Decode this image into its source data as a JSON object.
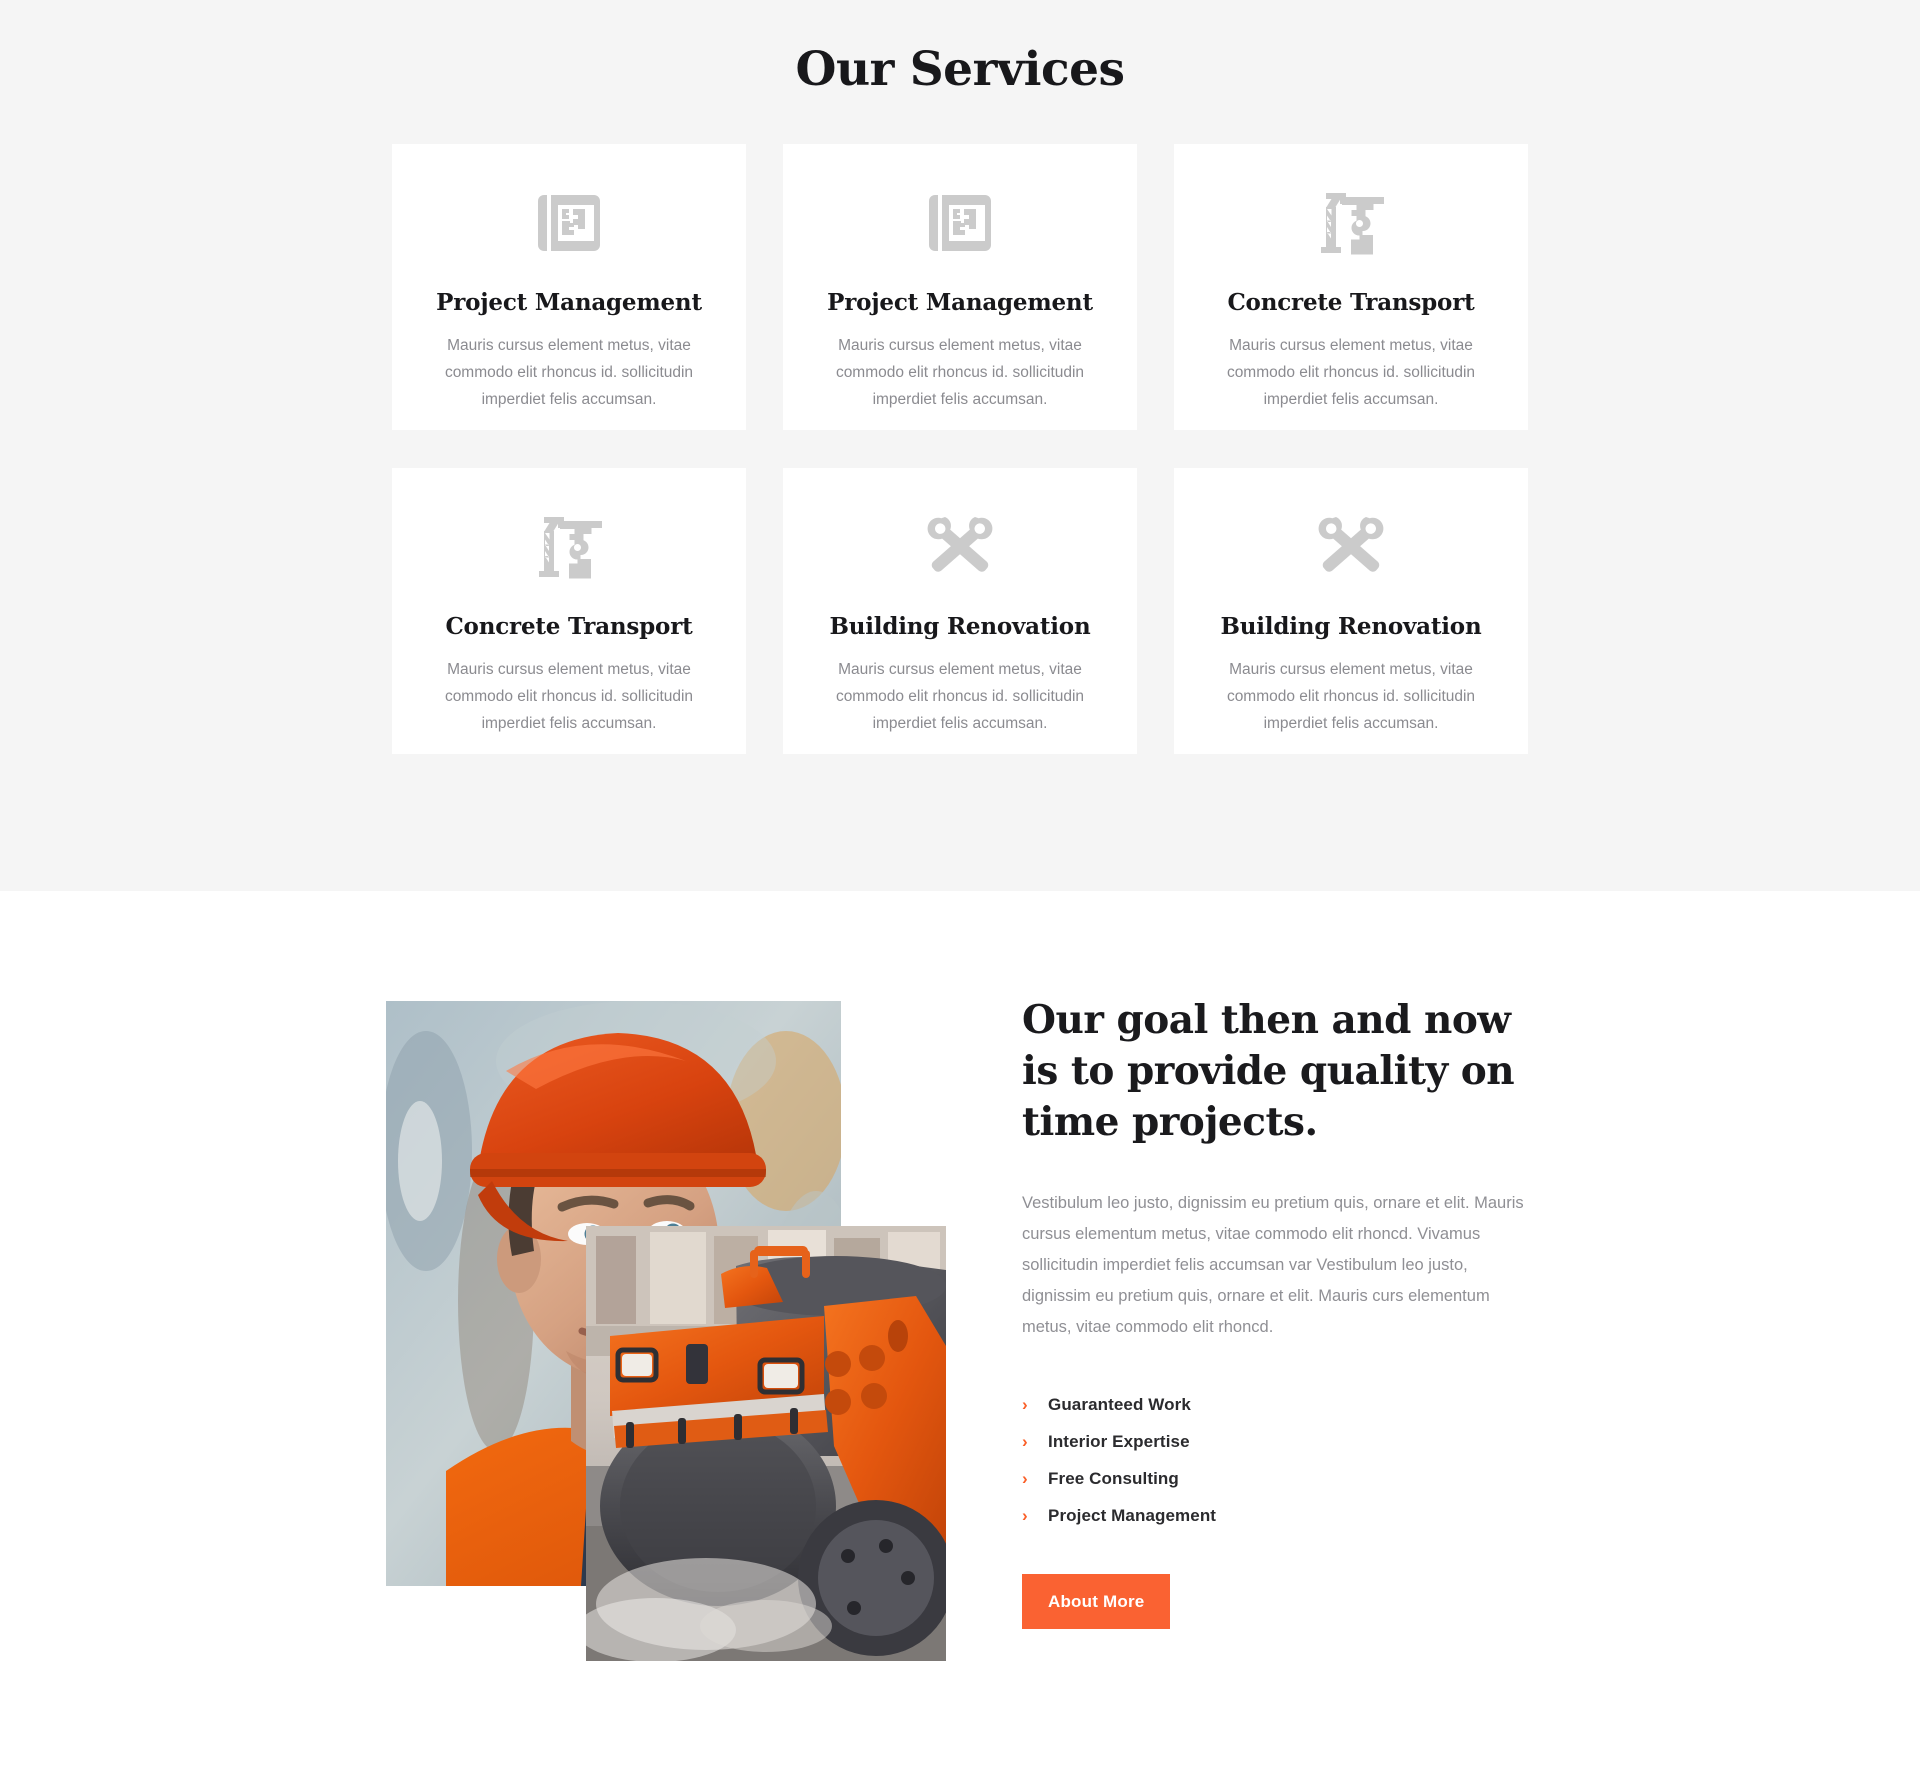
{
  "services": {
    "title": "Our Services",
    "cards": [
      {
        "icon": "blueprint-icon",
        "title": "Project Management",
        "desc": "Mauris cursus element metus, vitae commodo elit rhoncus id. sollicitudin imperdiet felis accumsan."
      },
      {
        "icon": "blueprint-icon",
        "title": "Project Management",
        "desc": "Mauris cursus element metus, vitae commodo elit rhoncus id. sollicitudin imperdiet felis accumsan."
      },
      {
        "icon": "crane-icon",
        "title": "Concrete Transport",
        "desc": "Mauris cursus element metus, vitae commodo elit rhoncus id. sollicitudin imperdiet felis accumsan."
      },
      {
        "icon": "crane-icon",
        "title": "Concrete Transport",
        "desc": "Mauris cursus element metus, vitae commodo elit rhoncus id. sollicitudin imperdiet felis accumsan."
      },
      {
        "icon": "wrenches-icon",
        "title": "Building Renovation",
        "desc": "Mauris cursus element metus, vitae commodo elit rhoncus id. sollicitudin imperdiet felis accumsan."
      },
      {
        "icon": "wrenches-icon",
        "title": "Building Renovation",
        "desc": "Mauris cursus element metus, vitae commodo elit rhoncus id. sollicitudin imperdiet felis accumsan."
      }
    ]
  },
  "about": {
    "heading": "Our goal then and now is to provide quality on time projects.",
    "paragraph": "Vestibulum leo justo, dignissim eu pretium quis, ornare et elit. Mauris cursus elementum metus, vitae commodo elit rhoncd. Vivamus sollicitudin imperdiet felis accumsan var Vestibulum leo justo, dignissim eu pretium quis, ornare et elit. Mauris curs elementum metus, vitae commodo elit rhoncd.",
    "chevron": "›",
    "features": [
      "Guaranteed Work",
      "Interior Expertise",
      "Free Consulting",
      "Project Management"
    ],
    "button_label": "About More",
    "images": [
      {
        "name": "worker-with-phone-photo",
        "alt": "Construction worker in orange hard hat and safety vest talking on a mobile phone"
      },
      {
        "name": "road-roller-photo",
        "alt": "Orange road roller compacting asphalt with dust"
      }
    ]
  },
  "colors": {
    "accent": "#fa6232",
    "chevron": "#fa5f28",
    "section_bg": "#f5f5f5",
    "card_bg": "#ffffff",
    "heading": "#18181b",
    "body_text": "#8b8b90",
    "icon": "#cbcbcb"
  }
}
